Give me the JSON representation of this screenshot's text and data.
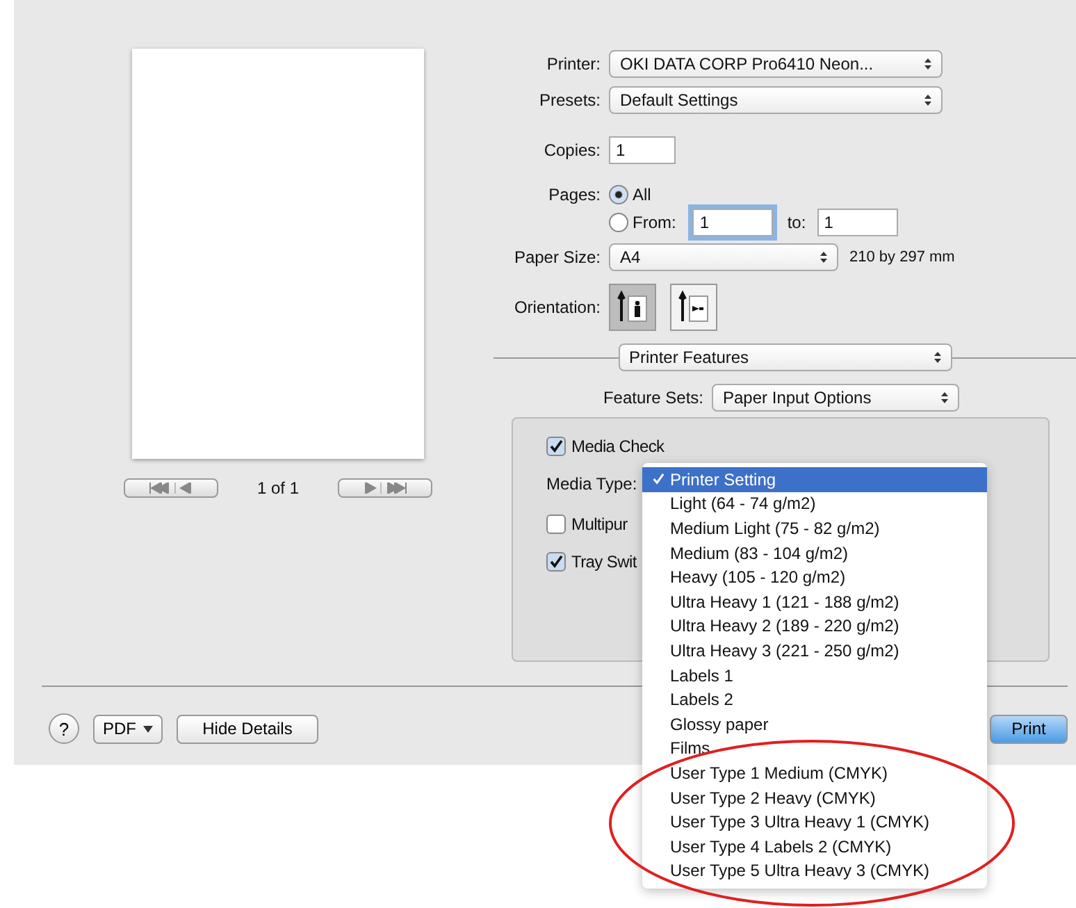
{
  "preview": {
    "page_counter": "1 of 1"
  },
  "printer": {
    "label": "Printer:",
    "value": "OKI DATA CORP Pro6410 Neon..."
  },
  "presets": {
    "label": "Presets:",
    "value": "Default Settings"
  },
  "copies": {
    "label": "Copies:",
    "value": "1"
  },
  "pages": {
    "label": "Pages:",
    "options": [
      {
        "label": "All",
        "selected": true
      },
      {
        "label": "From:",
        "selected": false
      }
    ],
    "from": "1",
    "to_label": "to:",
    "to": "1"
  },
  "paper_size": {
    "label": "Paper Size:",
    "value": "A4",
    "dimensions": "210 by 297 mm"
  },
  "orientation": {
    "label": "Orientation:",
    "options": [
      {
        "kind": "portrait",
        "selected": true
      },
      {
        "kind": "landscape",
        "selected": false
      }
    ]
  },
  "section_popup": "Printer Features",
  "feature_sets": {
    "label": "Feature Sets:",
    "value": "Paper Input Options"
  },
  "options": [
    {
      "kind": "checkbox",
      "label": "Media Check",
      "checked": true
    },
    {
      "kind": "popup",
      "label": "Media Type:"
    },
    {
      "kind": "checkbox",
      "label": "Multipur",
      "checked": false
    },
    {
      "kind": "checkbox",
      "label": "Tray Swit",
      "checked": true
    }
  ],
  "media_menu": [
    {
      "label": "Printer Setting",
      "selected": true
    },
    {
      "label": "Light (64 - 74 g/m2)",
      "selected": false
    },
    {
      "label": "Medium Light (75 - 82 g/m2)",
      "selected": false
    },
    {
      "label": "Medium (83 - 104 g/m2)",
      "selected": false
    },
    {
      "label": "Heavy (105 - 120 g/m2)",
      "selected": false
    },
    {
      "label": "Ultra Heavy 1 (121 - 188 g/m2)",
      "selected": false
    },
    {
      "label": "Ultra Heavy 2 (189 - 220 g/m2)",
      "selected": false
    },
    {
      "label": "Ultra Heavy 3 (221 - 250 g/m2)",
      "selected": false
    },
    {
      "label": "Labels 1",
      "selected": false
    },
    {
      "label": "Labels 2",
      "selected": false
    },
    {
      "label": "Glossy paper",
      "selected": false
    },
    {
      "label": "Films",
      "selected": false
    },
    {
      "label": "User Type 1 Medium (CMYK)",
      "selected": false
    },
    {
      "label": "User Type 2 Heavy (CMYK)",
      "selected": false
    },
    {
      "label": "User Type 3 Ultra Heavy 1 (CMYK)",
      "selected": false
    },
    {
      "label": "User Type 4 Labels 2 (CMYK)",
      "selected": false
    },
    {
      "label": "User Type 5 Ultra Heavy 3 (CMYK)",
      "selected": false
    }
  ],
  "buttons": {
    "help": "?",
    "pdf": "PDF",
    "hide_details": "Hide Details",
    "print": "Print"
  }
}
